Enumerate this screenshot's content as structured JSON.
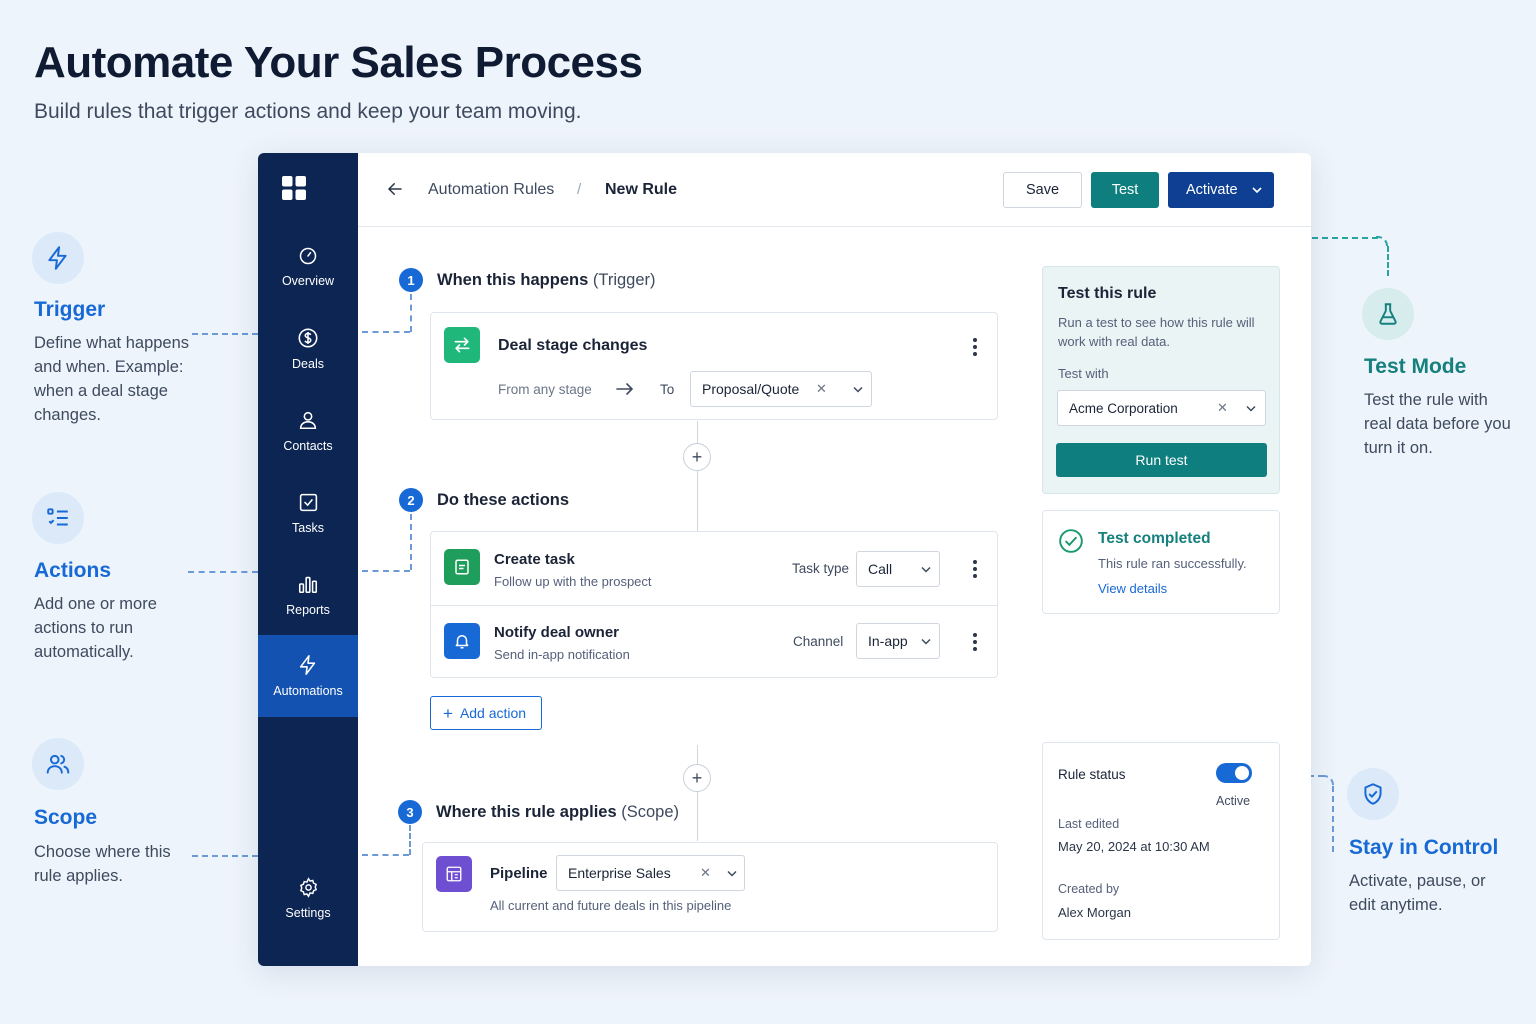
{
  "hero": {
    "title": "Automate Your Sales Process",
    "subtitle": "Build rules that trigger actions and keep your team moving."
  },
  "annotations": {
    "trigger": {
      "title": "Trigger",
      "text": "Define what happens and when. Example: when a deal stage changes.",
      "icon": "lightning-icon"
    },
    "actions": {
      "title": "Actions",
      "text": "Add one or more actions to run automatically.",
      "icon": "list-icon"
    },
    "scope": {
      "title": "Scope",
      "text": "Choose where this rule applies.",
      "icon": "users-icon"
    },
    "test_mode": {
      "title": "Test Mode",
      "text": "Test the rule with real data before you turn it on.",
      "icon": "flask-icon"
    },
    "stay_in_control": {
      "title": "Stay in Control",
      "text": "Activate, pause, or edit anytime.",
      "icon": "shield-check-icon"
    }
  },
  "sidebar": {
    "items": [
      {
        "label": "Overview",
        "icon": "gauge-icon"
      },
      {
        "label": "Deals",
        "icon": "dollar-icon"
      },
      {
        "label": "Contacts",
        "icon": "person-icon"
      },
      {
        "label": "Tasks",
        "icon": "checkbox-icon"
      },
      {
        "label": "Reports",
        "icon": "bar-chart-icon"
      },
      {
        "label": "Automations",
        "icon": "lightning-icon",
        "active": true
      }
    ],
    "settings": {
      "label": "Settings",
      "icon": "gear-icon"
    }
  },
  "topbar": {
    "breadcrumb_parent": "Automation Rules",
    "breadcrumb_separator": "/",
    "breadcrumb_current": "New Rule",
    "save_label": "Save",
    "test_label": "Test",
    "activate_label": "Activate"
  },
  "trigger": {
    "step": "1",
    "title": "When this happens",
    "title_suffix": "(Trigger)",
    "name": "Deal stage changes",
    "from_label": "From any stage",
    "to_label": "To",
    "to_value": "Proposal/Quote"
  },
  "actions": {
    "step": "2",
    "title": "Do these actions",
    "items": [
      {
        "title": "Create task",
        "subtitle": "Follow up with the prospect",
        "field_label": "Task type",
        "field_value": "Call"
      },
      {
        "title": "Notify deal owner",
        "subtitle": "Send in-app notification",
        "field_label": "Channel",
        "field_value": "In-app"
      }
    ],
    "add_label": "Add action"
  },
  "scope": {
    "step": "3",
    "title": "Where this rule applies",
    "title_suffix": "(Scope)",
    "pipeline_label": "Pipeline",
    "pipeline_value": "Enterprise Sales",
    "pipeline_note": "All current and future deals in this pipeline"
  },
  "test_panel": {
    "title": "Test this rule",
    "description": "Run a test to see how this rule will work with real data.",
    "test_with_label": "Test with",
    "test_with_value": "Acme Corporation",
    "run_label": "Run test"
  },
  "test_result": {
    "title": "Test completed",
    "message": "This rule ran successfully.",
    "link": "View details"
  },
  "rule_status": {
    "label": "Rule status",
    "state": "Active",
    "enabled": true,
    "last_edited_label": "Last edited",
    "last_edited_value": "May 20, 2024 at 10:30 AM",
    "created_by_label": "Created by",
    "created_by_value": "Alex Morgan"
  },
  "colors": {
    "brand_blue": "#1769d6",
    "sidebar_navy": "#0c2552",
    "teal": "#0e7e7f",
    "activate_navy": "#0f3f93"
  }
}
